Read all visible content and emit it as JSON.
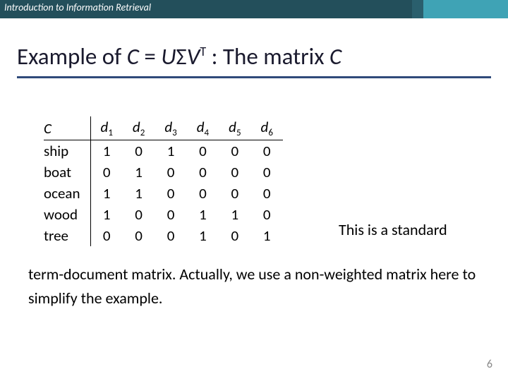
{
  "header": {
    "course": "Introduction to Information Retrieval"
  },
  "title": {
    "prefix": "Example of ",
    "C": "C",
    "eq": " = ",
    "U": "U",
    "Sigma": "Σ",
    "V": "V",
    "T": "T",
    "suffix1": " : The matrix ",
    "C2": "C"
  },
  "matrix": {
    "corner": "C",
    "cols": [
      "d",
      "d",
      "d",
      "d",
      "d",
      "d"
    ],
    "col_subs": [
      "1",
      "2",
      "3",
      "4",
      "5",
      "6"
    ],
    "rows": [
      "ship",
      "boat",
      "ocean",
      "wood",
      "tree"
    ],
    "values": [
      [
        "1",
        "0",
        "1",
        "0",
        "0",
        "0"
      ],
      [
        "0",
        "1",
        "0",
        "0",
        "0",
        "0"
      ],
      [
        "1",
        "1",
        "0",
        "0",
        "0",
        "0"
      ],
      [
        "1",
        "0",
        "0",
        "1",
        "1",
        "0"
      ],
      [
        "0",
        "0",
        "0",
        "1",
        "0",
        "1"
      ]
    ]
  },
  "body": {
    "line1": "This is a standard",
    "line2": "term-document matrix. Actually, we use a non-weighted matrix here to simplify the example."
  },
  "page": "6",
  "chart_data": {
    "type": "table",
    "title": "Term-document matrix C",
    "columns": [
      "d1",
      "d2",
      "d3",
      "d4",
      "d5",
      "d6"
    ],
    "rows": [
      "ship",
      "boat",
      "ocean",
      "wood",
      "tree"
    ],
    "values": [
      [
        1,
        0,
        1,
        0,
        0,
        0
      ],
      [
        0,
        1,
        0,
        0,
        0,
        0
      ],
      [
        1,
        1,
        0,
        0,
        0,
        0
      ],
      [
        1,
        0,
        0,
        1,
        1,
        0
      ],
      [
        0,
        0,
        0,
        1,
        0,
        1
      ]
    ]
  }
}
